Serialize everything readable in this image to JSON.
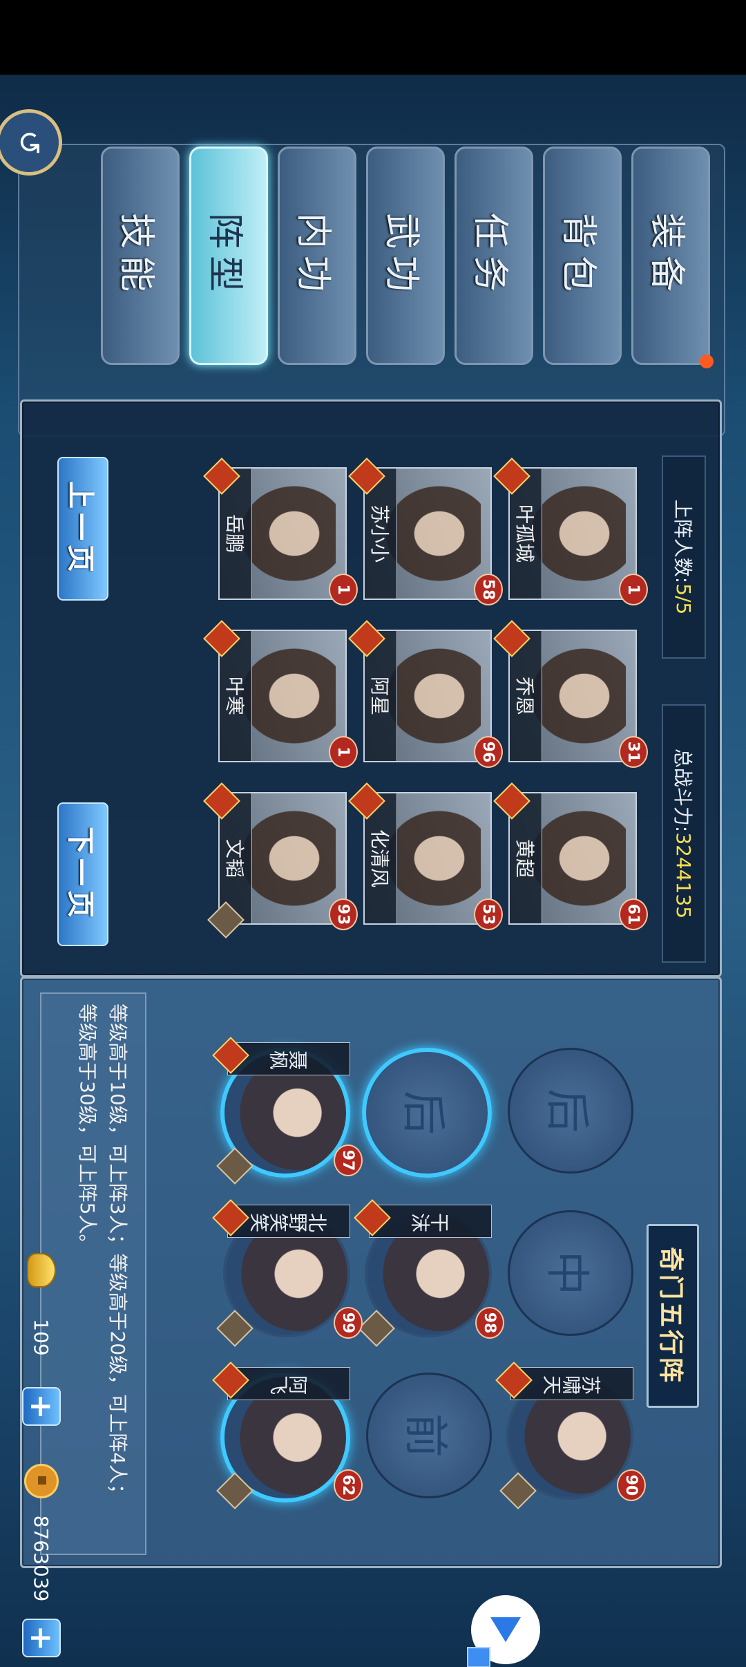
{
  "tabs": [
    {
      "label": "装备",
      "active": false,
      "badge": true
    },
    {
      "label": "背包",
      "active": false,
      "badge": false
    },
    {
      "label": "任务",
      "active": false,
      "badge": false
    },
    {
      "label": "武功",
      "active": false,
      "badge": false
    },
    {
      "label": "内功",
      "active": false,
      "badge": false
    },
    {
      "label": "阵型",
      "active": true,
      "badge": false
    },
    {
      "label": "技能",
      "active": false,
      "badge": false
    }
  ],
  "roster": {
    "on_field_label": "上阵人数:",
    "on_field_value": "5/5",
    "power_label": "总战斗力:",
    "power_value": "3244135",
    "heroes": [
      {
        "name": "叶孤城",
        "level": "1"
      },
      {
        "name": "乔恩",
        "level": "31"
      },
      {
        "name": "黄超",
        "level": "61"
      },
      {
        "name": "苏小小",
        "level": "58"
      },
      {
        "name": "阿星",
        "level": "96"
      },
      {
        "name": "化清风",
        "level": "53"
      },
      {
        "name": "岳鹏",
        "level": "1"
      },
      {
        "name": "叶寒",
        "level": "1"
      },
      {
        "name": "文韬",
        "level": "93"
      }
    ],
    "prev_button": "上一页",
    "next_button": "下一页"
  },
  "formation": {
    "title": "奇门五行阵",
    "slot_back": "后",
    "slot_mid": "中",
    "slot_front": "前",
    "members": [
      {
        "name": "苏啸天",
        "level": "90"
      },
      {
        "name": "干沫",
        "level": "98"
      },
      {
        "name": "北野笑笑",
        "level": "99"
      },
      {
        "name": "聂枫",
        "level": "97"
      },
      {
        "name": "阿飞",
        "level": "62"
      }
    ],
    "tip_line1": "等级高于10级，可上阵3人；等级高于20级，可上阵4人；",
    "tip_line2": "等级高于30级，可上阵5人。"
  },
  "resources": {
    "gold": "109",
    "coins": "8763039"
  },
  "icons": {
    "back": "back-arrow-icon",
    "gold": "gold-ingot-icon",
    "coin": "copper-coin-icon",
    "plus": "plus-icon",
    "float": "down-triangle-icon"
  }
}
